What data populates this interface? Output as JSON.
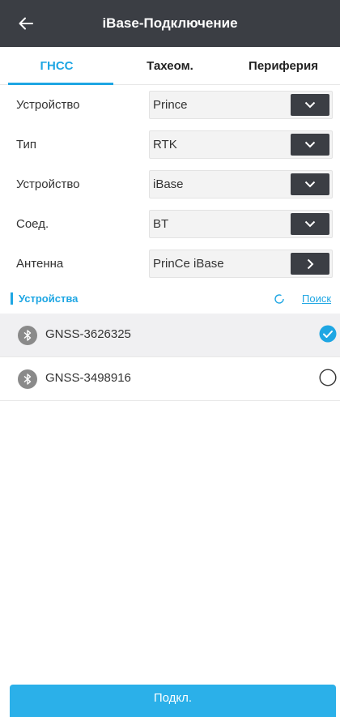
{
  "header": {
    "title": "iBase-Подключение",
    "back_icon": "arrow-left-icon"
  },
  "tabs": [
    {
      "label": "ГНСС",
      "active": true
    },
    {
      "label": "Тахеом.",
      "active": false
    },
    {
      "label": "Периферия",
      "active": false
    }
  ],
  "form": {
    "rows": [
      {
        "label": "Устройство",
        "value": "Prince",
        "button_icon": "chevron-down-icon"
      },
      {
        "label": "Тип",
        "value": "RTK",
        "button_icon": "chevron-down-icon"
      },
      {
        "label": "Устройство",
        "value": "iBase",
        "button_icon": "chevron-down-icon"
      },
      {
        "label": "Соед.",
        "value": "BT",
        "button_icon": "chevron-down-icon"
      },
      {
        "label": "Антенна",
        "value": "PrinCe iBase",
        "button_icon": "chevron-right-icon"
      }
    ]
  },
  "devices": {
    "title": "Устройства",
    "search_label": "Поиск",
    "items": [
      {
        "name": "GNSS-3626325",
        "selected": true
      },
      {
        "name": "GNSS-3498916",
        "selected": false
      }
    ]
  },
  "footer": {
    "connect_label": "Подкл."
  },
  "colors": {
    "accent": "#1ea6e3",
    "header_bg": "#3b3e44",
    "button_bg": "#2bb0e9"
  }
}
